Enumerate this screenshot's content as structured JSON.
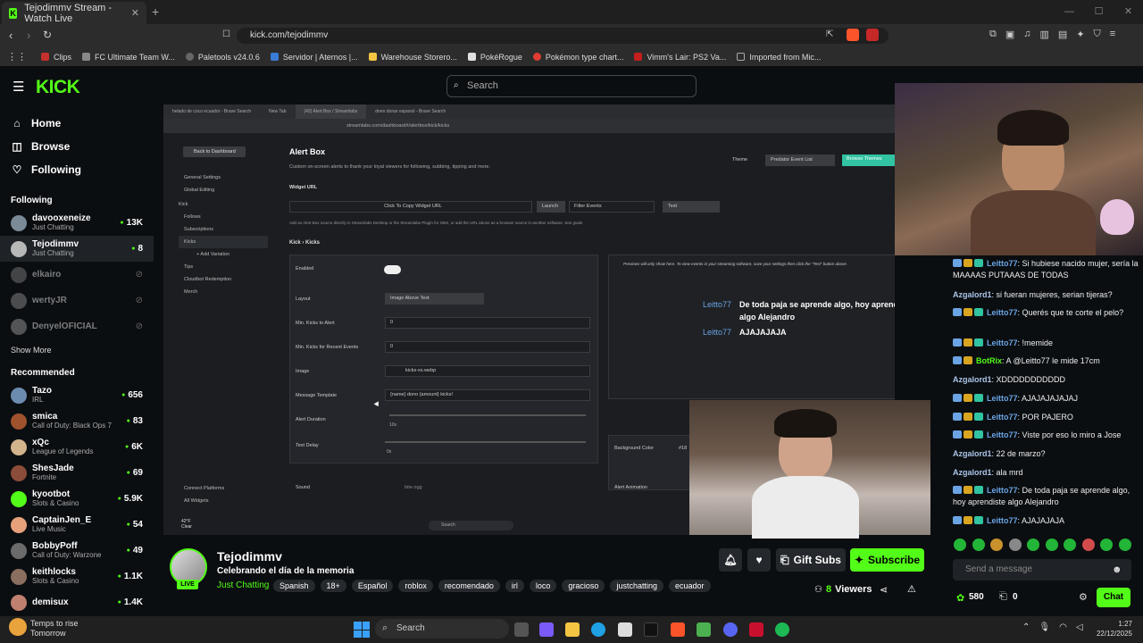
{
  "browser": {
    "tab_title": "Tejodimmv Stream - Watch Live",
    "url": "kick.com/tejodimmv",
    "bookmarks": [
      {
        "label": "Clips",
        "color": "#c4302b"
      },
      {
        "label": "FC Ultimate Team W...",
        "color": "#888888"
      },
      {
        "label": "Paletools v24.0.6",
        "color": "#666666"
      },
      {
        "label": "Servidor | Aternos |...",
        "color": "#3a7bd5"
      },
      {
        "label": "Warehouse Storero...",
        "color": "#f4c542"
      },
      {
        "label": "PokéRogue",
        "color": "#e0e0e0"
      },
      {
        "label": "Pokémon type chart...",
        "color": "#e03c31"
      },
      {
        "label": "Vimm's Lair: PS2 Va...",
        "color": "#c41e1e"
      },
      {
        "label": "Imported from Mic...",
        "color": "#aaaaaa"
      }
    ]
  },
  "kick": {
    "logo": "KICK",
    "search_placeholder": "Search",
    "nav": {
      "home": "Home",
      "browse": "Browse",
      "following": "Following"
    },
    "following_title": "Following",
    "following": [
      {
        "name": "davooxeneize",
        "category": "Just Chatting",
        "viewers": "13K",
        "online": true,
        "avatar": "#7a8a96"
      },
      {
        "name": "Tejodimmv",
        "category": "Just Chatting",
        "viewers": "8",
        "online": true,
        "avatar": "#b8b8b8"
      },
      {
        "name": "elkairo",
        "category": "",
        "viewers": "",
        "online": false,
        "avatar": "#888888"
      },
      {
        "name": "wertyJR",
        "category": "",
        "viewers": "",
        "online": false,
        "avatar": "#999999"
      },
      {
        "name": "DenyelOFICIAL",
        "category": "",
        "viewers": "",
        "online": false,
        "avatar": "#aaaaaa"
      }
    ],
    "show_more": "Show More",
    "recommended_title": "Recommended",
    "recommended": [
      {
        "name": "Tazo",
        "category": "IRL",
        "viewers": "656",
        "avatar": "#6b8caf"
      },
      {
        "name": "smica",
        "category": "Call of Duty: Black Ops 7",
        "viewers": "83",
        "avatar": "#a0522d"
      },
      {
        "name": "xQc",
        "category": "League of Legends",
        "viewers": "6K",
        "avatar": "#d2b48c"
      },
      {
        "name": "ShesJade",
        "category": "Fortnite",
        "viewers": "69",
        "avatar": "#8b4c39"
      },
      {
        "name": "kyootbot",
        "category": "Slots & Casino",
        "viewers": "5.9K",
        "avatar": "#53fc18"
      },
      {
        "name": "CaptainJen_E",
        "category": "Live Music",
        "viewers": "54",
        "avatar": "#e6a17a"
      },
      {
        "name": "BobbyPoff",
        "category": "Call of Duty: Warzone",
        "viewers": "49",
        "avatar": "#6b6b6b"
      },
      {
        "name": "keithlocks",
        "category": "Slots & Casino",
        "viewers": "1.1K",
        "avatar": "#8a6e5e"
      },
      {
        "name": "demisux",
        "category": "",
        "viewers": "1.4K",
        "avatar": "#c08070"
      }
    ]
  },
  "stream_content": {
    "tabs": [
      "helado de coco ecuador - Brave Search",
      "New Tab",
      "(42) Alert Box / Streamlabs",
      "dono donar espanol - Brave Search"
    ],
    "address": "streamlabs.com/dashboard#/alertbox/kick/kicks",
    "back_btn": "Back to Dashboard",
    "side_items": [
      "General Settings",
      "Global Editing",
      "Kick",
      "Follows",
      "Subscriptions",
      "Kicks",
      "+ Add Variation",
      "Tips",
      "Cloudbot Redemption",
      "Merch"
    ],
    "side_bottom": [
      "Connect Platforms",
      "All Widgets"
    ],
    "title": "Alert Box",
    "description": "Custom on-screen alerts to thank your loyal viewers for following, subbing, tipping and more.",
    "widget_url_label": "Widget URL",
    "copy_url": "Click To Copy Widget URL",
    "launch": "Launch",
    "filter": "Filter Events",
    "test": "Test",
    "theme_label": "Theme",
    "theme_value": "Predator Event List",
    "browse_themes": "Browse Themes",
    "add_note": "Add an Alert Box source directly in Streamlabs Desktop or the Streamlabs Plugin for OBS, or add the URL above as a browser source in another software. See guide",
    "breadcrumb": "Kick › Kicks",
    "preview_note": "Previews will only show here. To view events in your streaming software, save your settings then click the \"Test\" button above.",
    "fields": [
      {
        "label": "Enabled",
        "value": ""
      },
      {
        "label": "Layout",
        "value": "Image Above Text"
      },
      {
        "label": "Min. Kicks to Alert",
        "value": "0"
      },
      {
        "label": "Min. Kicks for Recent Events",
        "value": "0"
      },
      {
        "label": "Image",
        "value": "kicks-xs.webp"
      },
      {
        "label": "Message Template",
        "value": "{name} dono {amount} kicks!"
      },
      {
        "label": "Alert Duration",
        "value": "10s"
      },
      {
        "label": "Text Delay",
        "value": "0s"
      },
      {
        "label": "Sound",
        "value": "bite.ogg"
      }
    ],
    "bg_color_label": "Background Color",
    "bg_color_value": "#18",
    "alert_anim_label": "Alert Animation",
    "alert_msgs": [
      {
        "user": "Leitto77",
        "text": "De toda paja se aprende algo, hoy aprendiste algo Alejandro"
      },
      {
        "user": "Leitto77",
        "text": "AJAJAJAJA"
      }
    ],
    "weather_temp": "42°F",
    "weather_cond": "Clear",
    "inner_search": "Search"
  },
  "stream_info": {
    "name": "Tejodimmv",
    "live": "LIVE",
    "title": "Celebrando el día de la memoria",
    "category": "Just Chatting",
    "tags": [
      "Spanish",
      "18+",
      "Español",
      "roblox",
      "recomendado",
      "irl",
      "loco",
      "gracioso",
      "justchatting",
      "ecuador"
    ],
    "viewers_count": "8",
    "viewers_label": "Viewers",
    "gift_subs": "Gift Subs",
    "subscribe": "Subscribe"
  },
  "chat": {
    "messages": [
      {
        "user": "Leitto77",
        "text": "Si hubiese nacido mujer, sería la MAAAAS PUTAAAS DE TODAS",
        "color": "#6aa4e4",
        "badges": 3
      },
      {
        "user": "Azgalord1",
        "text": "si fueran mujeres, serian tijeras?",
        "color": "#a9c5e8",
        "badges": 0
      },
      {
        "user": "Leitto77",
        "text": "Querés que te corte el pelo?",
        "color": "#6aa4e4",
        "badges": 3
      },
      {
        "user": "Leitto77",
        "text": "!memide",
        "color": "#6aa4e4",
        "badges": 3
      },
      {
        "user": "BotRix",
        "text": "A @Leitto77 le mide 17cm",
        "color": "#53fc18",
        "badges": 2
      },
      {
        "user": "Azgalord1",
        "text": "XDDDDDDDDDDD",
        "color": "#a9c5e8",
        "badges": 0
      },
      {
        "user": "Leitto77",
        "text": "AJAJAJAJAJAJ",
        "color": "#6aa4e4",
        "badges": 3
      },
      {
        "user": "Leitto77",
        "text": "POR PAJERO",
        "color": "#6aa4e4",
        "badges": 3
      },
      {
        "user": "Leitto77",
        "text": "Viste por eso lo miro a Jose",
        "color": "#6aa4e4",
        "badges": 3
      },
      {
        "user": "Azgalord1",
        "text": "22 de marzo?",
        "color": "#a9c5e8",
        "badges": 0
      },
      {
        "user": "Azgalord1",
        "text": "ala mrd",
        "color": "#a9c5e8",
        "badges": 0
      },
      {
        "user": "Leitto77",
        "text": "De toda paja se aprende algo, hoy aprendiste algo Alejandro",
        "color": "#6aa4e4",
        "badges": 3
      },
      {
        "user": "Leitto77",
        "text": "AJAJAJAJA",
        "color": "#6aa4e4",
        "badges": 3
      }
    ],
    "placeholder": "Send a message",
    "points": "580",
    "gifts": "0",
    "chat_btn": "Chat"
  },
  "taskbar": {
    "weather_title": "Temps to rise",
    "weather_sub": "Tomorrow",
    "search": "Search",
    "time": "1:27",
    "date": "22/12/2025"
  }
}
